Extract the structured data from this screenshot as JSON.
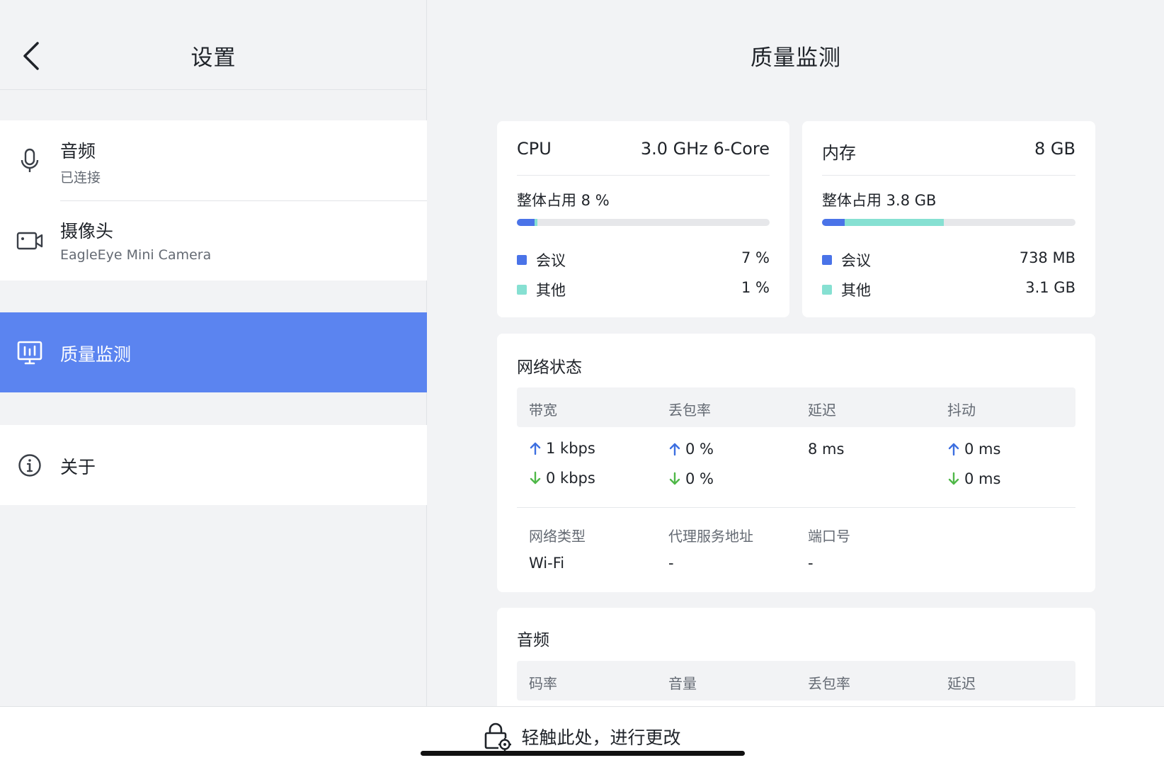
{
  "left": {
    "title": "设置",
    "items": [
      {
        "label": "音频",
        "sub": "已连接",
        "icon": "microphone-icon"
      },
      {
        "label": "摄像头",
        "sub": "EagleEye Mini Camera",
        "icon": "camera-icon"
      },
      {
        "label": "质量监测",
        "icon": "monitor-chart-icon",
        "active": true
      },
      {
        "label": "关于",
        "icon": "info-icon"
      }
    ]
  },
  "right": {
    "title": "质量监测",
    "cpu": {
      "label": "CPU",
      "spec": "3.0 GHz 6-Core",
      "usage": "整体占用 8 %",
      "meeting_fraction": 0.07,
      "other_fraction": 0.01,
      "legend": [
        {
          "name": "会议",
          "value": "7 %"
        },
        {
          "name": "其他",
          "value": "1 %"
        }
      ]
    },
    "memory": {
      "label": "内存",
      "spec": "8 GB",
      "usage": "整体占用 3.8 GB",
      "meeting_fraction": 0.09,
      "other_fraction": 0.39,
      "legend": [
        {
          "name": "会议",
          "value": "738 MB"
        },
        {
          "name": "其他",
          "value": "3.1 GB"
        }
      ]
    },
    "network": {
      "title": "网络状态",
      "headers": [
        "带宽",
        "丢包率",
        "延迟",
        "抖动"
      ],
      "bandwidth_up": "1 kbps",
      "bandwidth_down": "0 kbps",
      "loss_up": "0 %",
      "loss_down": "0 %",
      "latency": "8 ms",
      "jitter_up": "0 ms",
      "jitter_down": "0 ms",
      "type_label": "网络类型",
      "type_value": "Wi-Fi",
      "proxy_label": "代理服务地址",
      "proxy_value": "-",
      "port_label": "端口号",
      "port_value": "-"
    },
    "audio": {
      "title": "音频",
      "headers": [
        "码率",
        "音量",
        "丢包率",
        "延迟"
      ]
    }
  },
  "bottom": {
    "lock_hint": "轻触此处，进行更改"
  },
  "colors": {
    "accent": "#5b84f0",
    "meeting": "#4a73e8",
    "other": "#86e0d2",
    "up_arrow": "#3d6fe0",
    "down_arrow": "#4fb848"
  }
}
